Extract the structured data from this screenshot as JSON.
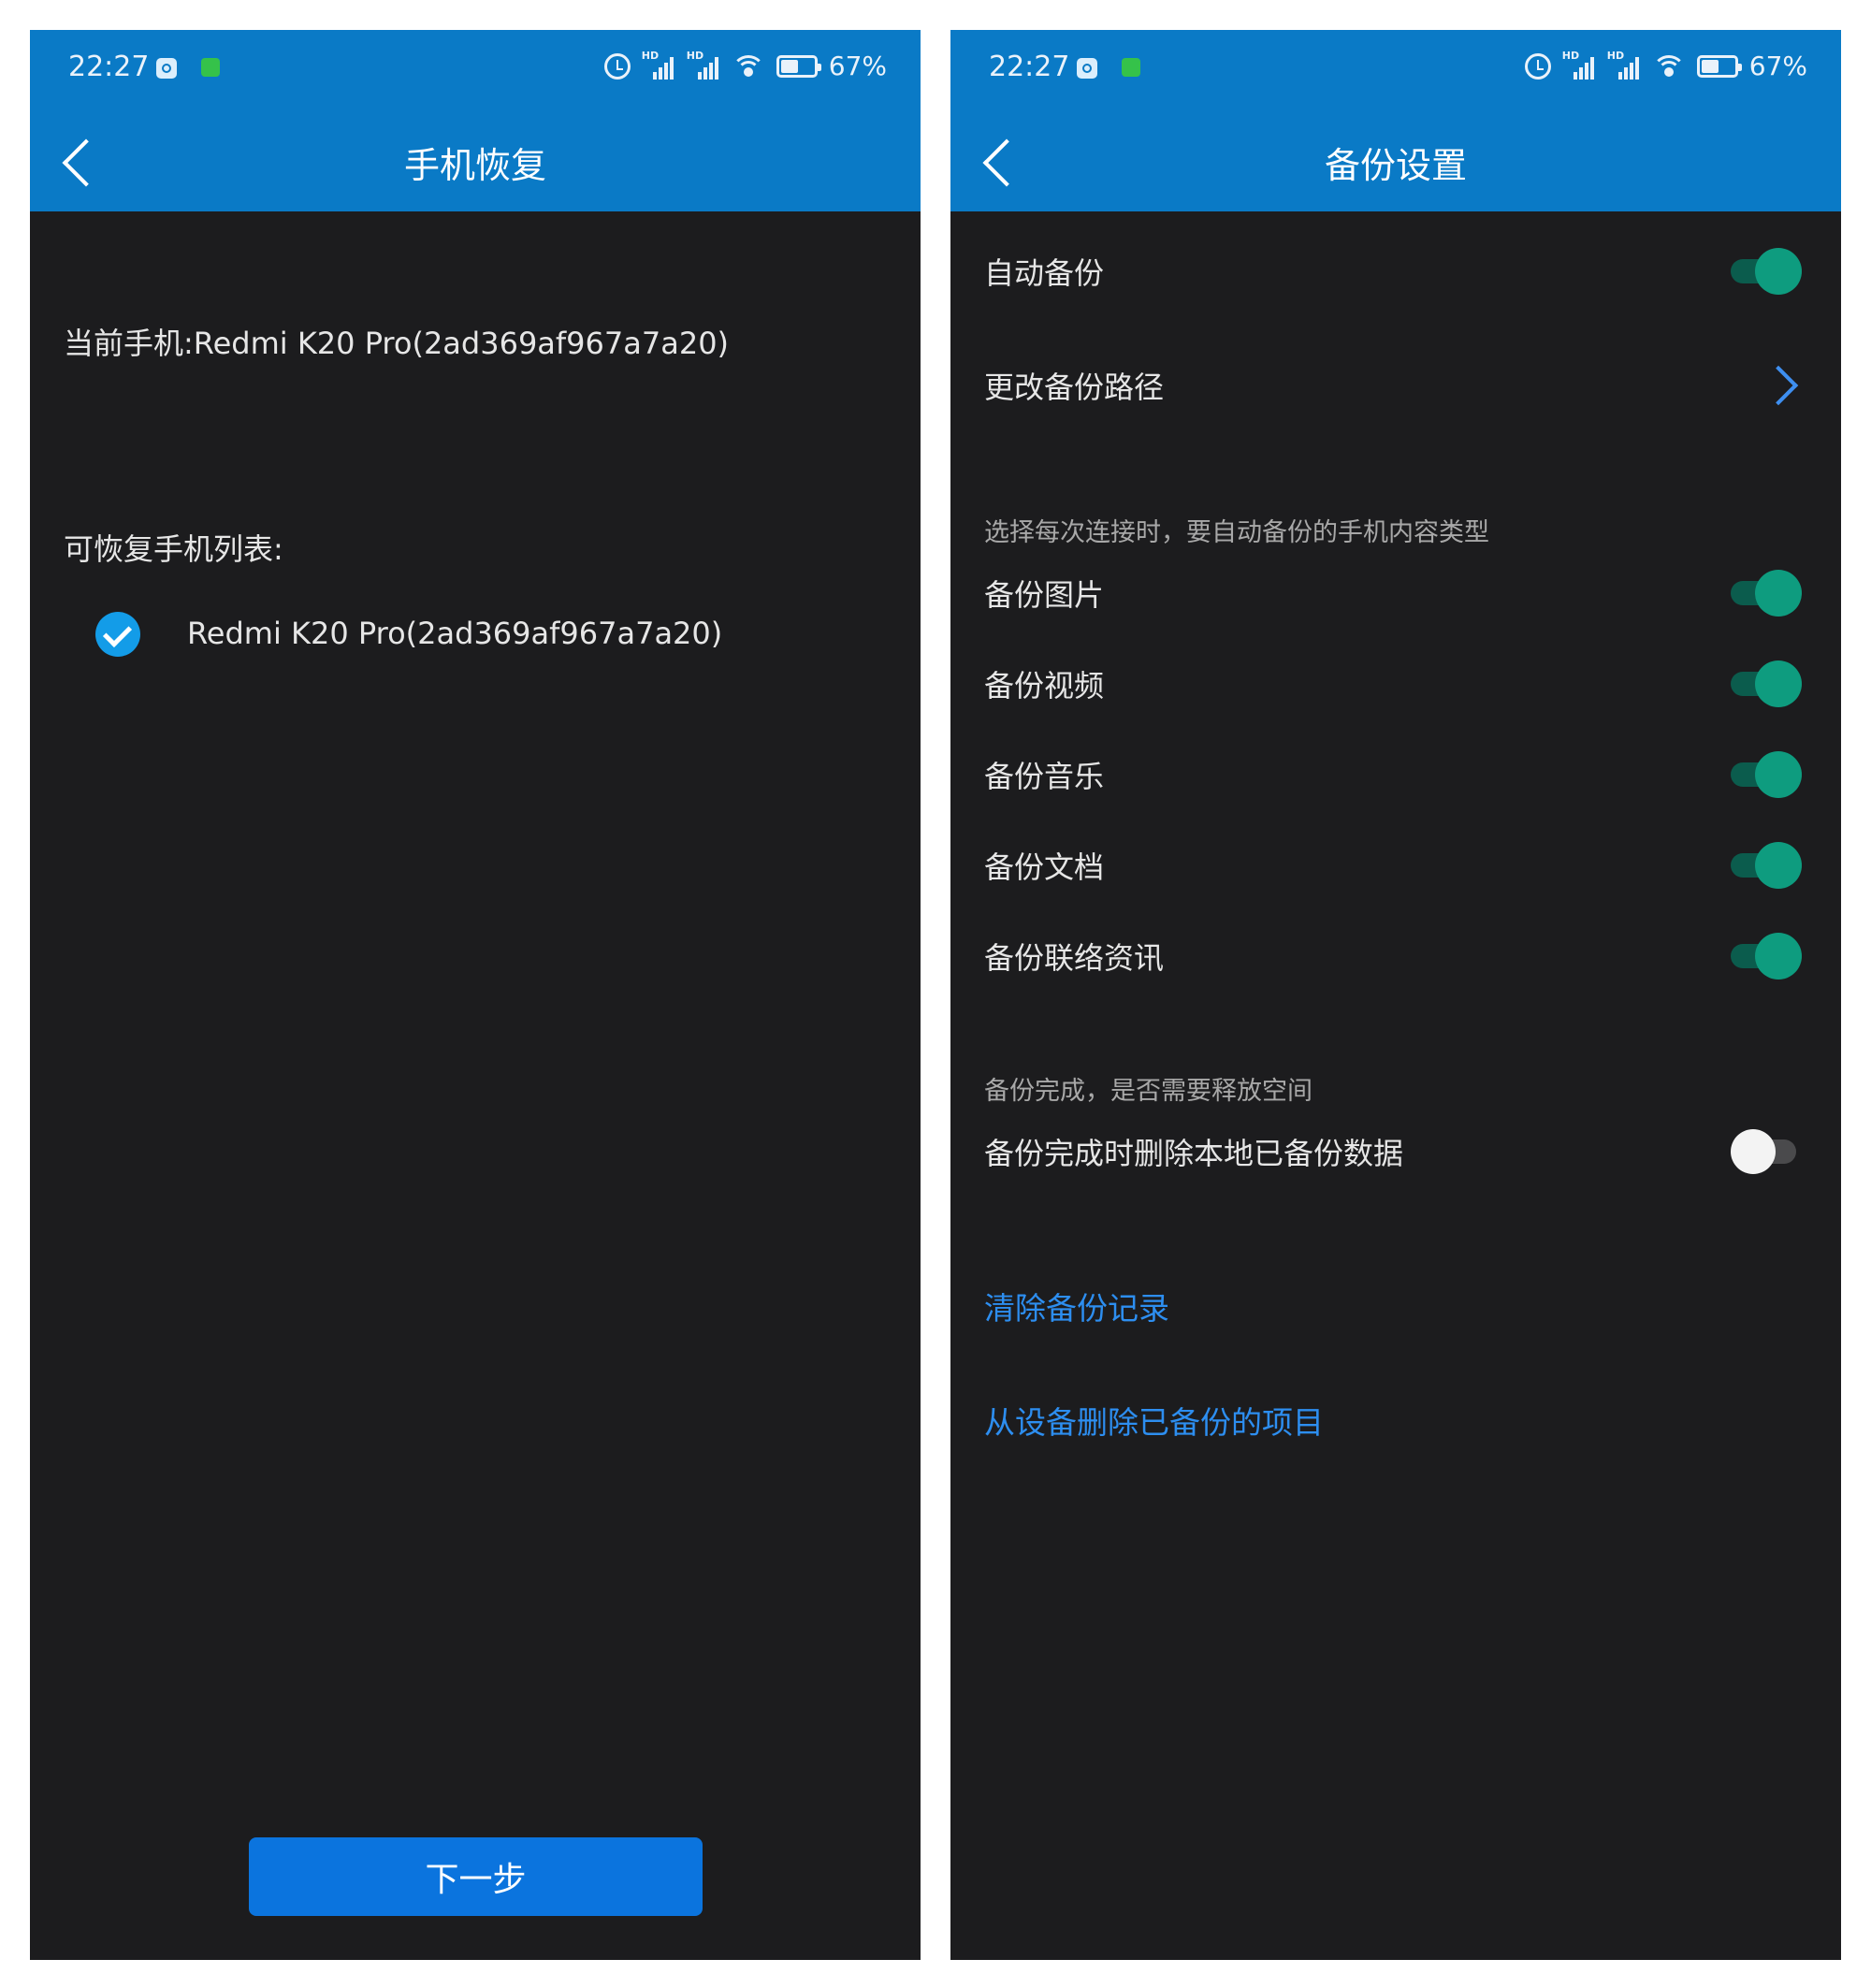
{
  "status_bar": {
    "time": "22:27",
    "battery_percent": "67%",
    "signal_label": "HD"
  },
  "left_screen": {
    "title": "手机恢复",
    "current_phone": "当前手机:Redmi K20 Pro(2ad369af967a7a20)",
    "list_heading": "可恢复手机列表:",
    "devices": [
      {
        "name": "Redmi K20 Pro(2ad369af967a7a20)",
        "checked": true
      }
    ],
    "next_button": "下一步"
  },
  "right_screen": {
    "title": "备份设置",
    "auto_backup": {
      "label": "自动备份",
      "on": true
    },
    "change_path": {
      "label": "更改备份路径"
    },
    "content_section": "选择每次连接时，要自动备份的手机内容类型",
    "content_toggles": [
      {
        "label": "备份图片",
        "on": true
      },
      {
        "label": "备份视频",
        "on": true
      },
      {
        "label": "备份音乐",
        "on": true
      },
      {
        "label": "备份文档",
        "on": true
      },
      {
        "label": "备份联络资讯",
        "on": true
      }
    ],
    "free_space_section": "备份完成，是否需要释放空间",
    "delete_after_backup": {
      "label": "备份完成时删除本地已备份数据",
      "on": false
    },
    "links": {
      "clear_history": "清除备份记录",
      "delete_items": "从设备删除已备份的项目"
    }
  },
  "colors": {
    "header_blue": "#0a7ac6",
    "background": "#1c1c1e",
    "toggle_on": "#0e9c7f",
    "link_blue": "#2d8ef0",
    "button_blue": "#0b74de"
  }
}
